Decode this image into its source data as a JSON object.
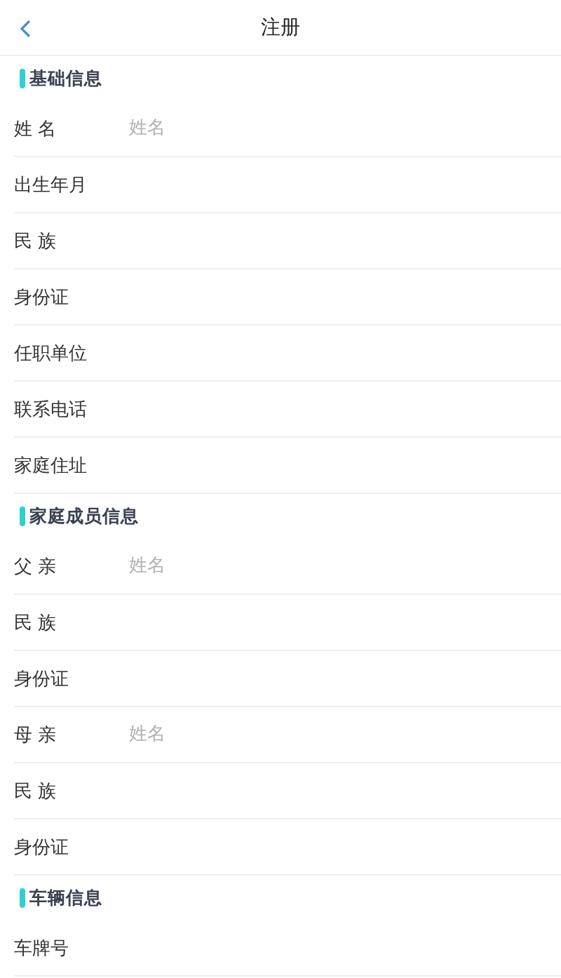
{
  "header": {
    "title": "注册"
  },
  "sections": [
    {
      "title": "基础信息",
      "fields": [
        {
          "label": "姓 名",
          "placeholder": "姓名"
        },
        {
          "label": "出生年月"
        },
        {
          "label": "民 族"
        },
        {
          "label": "身份证"
        },
        {
          "label": "任职单位"
        },
        {
          "label": "联系电话"
        },
        {
          "label": "家庭住址"
        }
      ]
    },
    {
      "title": "家庭成员信息",
      "fields": [
        {
          "label": "父 亲",
          "placeholder": "姓名"
        },
        {
          "label": "民 族"
        },
        {
          "label": "身份证"
        },
        {
          "label": "母 亲",
          "placeholder": "姓名"
        },
        {
          "label": "民 族"
        },
        {
          "label": "身份证"
        }
      ]
    },
    {
      "title": "车辆信息",
      "fields": [
        {
          "label": "车牌号"
        }
      ]
    }
  ]
}
